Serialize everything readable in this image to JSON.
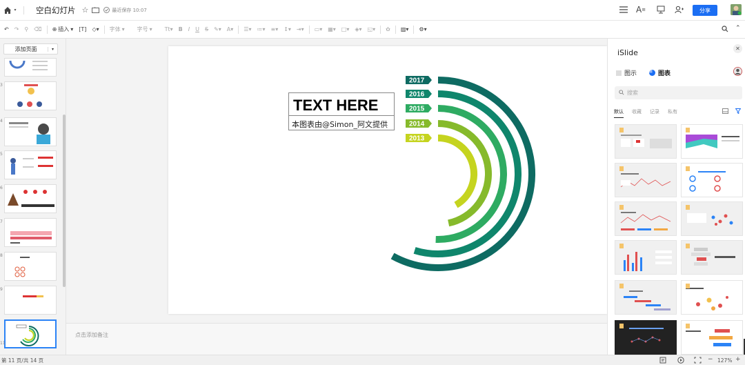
{
  "app": {
    "doc_title": "空白幻灯片",
    "save_status": "最近保存 10:07",
    "share_label": "分享"
  },
  "toolbar": {
    "insert_label": "插入",
    "font_label": "字体",
    "size_label": "字号"
  },
  "left_panel": {
    "add_page_label": "添加页面",
    "page_numbers": [
      "3",
      "4",
      "5",
      "6",
      "7",
      "8",
      "9",
      "10",
      "11"
    ]
  },
  "slide": {
    "title_text": "TEXT HERE",
    "subtitle_text": "本图表由@Simon_阿文提供"
  },
  "chart_data": {
    "type": "radial-bar",
    "categories": [
      "2017",
      "2016",
      "2015",
      "2014",
      "2013"
    ],
    "colors": [
      "#0e6b62",
      "#0f866c",
      "#2eab62",
      "#86ba2b",
      "#c5d41f"
    ]
  },
  "notes": {
    "placeholder": "点击添加备注"
  },
  "status": {
    "page_info": "第 11 页/共 14 页",
    "zoom": "127%",
    "zoom_out": "−",
    "zoom_in": "+"
  },
  "right_panel": {
    "title": "iSlide",
    "tab_diagram": "图示",
    "tab_chart": "图表",
    "search_placeholder": "搜索",
    "sub_tabs": [
      "默认",
      "收藏",
      "记录",
      "私有"
    ]
  }
}
